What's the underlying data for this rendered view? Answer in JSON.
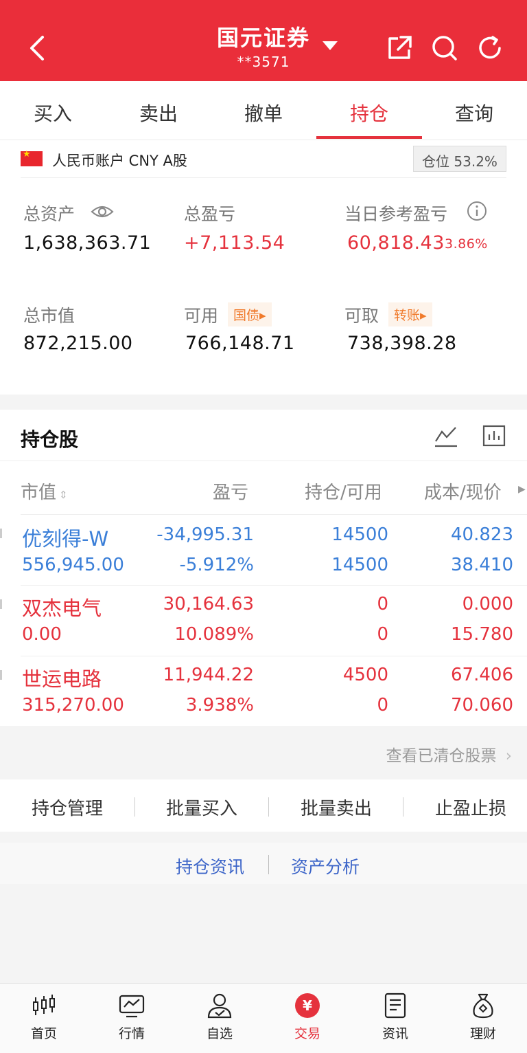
{
  "header": {
    "title": "国元证券",
    "account_masked": "**3571",
    "back_icon": "chevron-left-icon",
    "share_icon": "share-icon",
    "search_icon": "search-icon",
    "refresh_icon": "refresh-icon",
    "bg_color": "#ea2e3a"
  },
  "tabs": [
    {
      "label": "买入",
      "active": false
    },
    {
      "label": "卖出",
      "active": false
    },
    {
      "label": "撤单",
      "active": false
    },
    {
      "label": "持仓",
      "active": true
    },
    {
      "label": "查询",
      "active": false
    }
  ],
  "account": {
    "label": "人民币账户 CNY A股",
    "position_ratio": "仓位 53.2%",
    "total_assets_label": "总资产",
    "total_assets": "1,638,363.71",
    "total_pnl_label": "总盈亏",
    "total_pnl": "+7,113.54",
    "daily_pnl_label": "当日参考盈亏",
    "daily_pnl": "60,818.43",
    "daily_pnl_pct": "3.86%",
    "market_value_label": "总市值",
    "market_value": "872,215.00",
    "available_label": "可用",
    "available": "766,148.71",
    "available_tag": "国债▸",
    "withdrawable_label": "可取",
    "withdrawable": "738,398.28",
    "withdrawable_tag": "转账▸"
  },
  "holdings": {
    "title": "持仓股",
    "columns": [
      "市值",
      "盈亏",
      "持仓/可用",
      "成本/现价"
    ],
    "rows": [
      {
        "name": "优刻得-W",
        "market_value": "556,945.00",
        "pnl": "-34,995.31",
        "pnl_pct": "-5.912%",
        "position": "14500",
        "available": "14500",
        "cost": "40.823",
        "price": "38.410",
        "color": "blue"
      },
      {
        "name": "双杰电气",
        "market_value": "0.00",
        "pnl": "30,164.63",
        "pnl_pct": "10.089%",
        "position": "0",
        "available": "0",
        "cost": "0.000",
        "price": "15.780",
        "color": "red"
      },
      {
        "name": "世运电路",
        "market_value": "315,270.00",
        "pnl": "11,944.22",
        "pnl_pct": "3.938%",
        "position": "4500",
        "available": "0",
        "cost": "67.406",
        "price": "70.060",
        "color": "red"
      }
    ],
    "view_cleared": "查看已清仓股票"
  },
  "actions": [
    "持仓管理",
    "批量买入",
    "批量卖出",
    "止盈止损"
  ],
  "links": [
    "持仓资讯",
    "资产分析"
  ],
  "bottom_nav": [
    {
      "label": "首页",
      "icon": "candlestick-icon",
      "active": false
    },
    {
      "label": "行情",
      "icon": "chart-monitor-icon",
      "active": false
    },
    {
      "label": "自选",
      "icon": "person-check-icon",
      "active": false
    },
    {
      "label": "交易",
      "icon": "yuan-circle-icon",
      "active": true
    },
    {
      "label": "资讯",
      "icon": "document-icon",
      "active": false
    },
    {
      "label": "理财",
      "icon": "money-bag-icon",
      "active": false
    }
  ],
  "colors": {
    "accent_red": "#e5323d",
    "loss_blue": "#3b7fd8",
    "tag_orange": "#f07a2b"
  }
}
